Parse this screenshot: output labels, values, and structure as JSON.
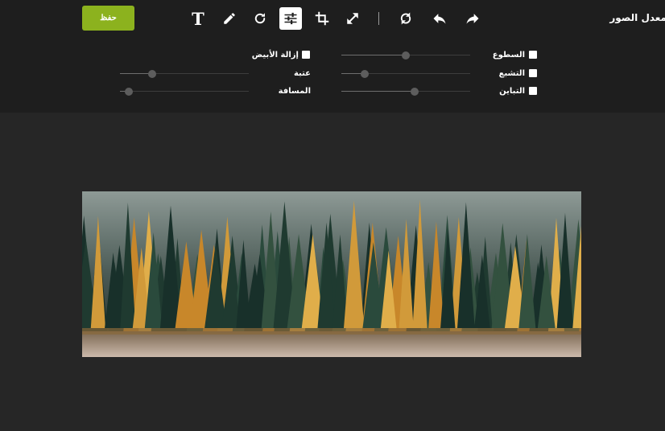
{
  "app": {
    "title": "معدل الصور"
  },
  "toolbar": {
    "save_label": "حفظ",
    "tools": [
      {
        "icon": "text-icon",
        "glyph": "T"
      },
      {
        "icon": "pencil-icon"
      },
      {
        "icon": "rotate-icon"
      },
      {
        "icon": "adjust-sliders-icon",
        "active": true
      },
      {
        "icon": "crop-icon"
      },
      {
        "icon": "resize-icon"
      },
      {
        "icon": "reset-icon"
      },
      {
        "icon": "undo-icon"
      },
      {
        "icon": "redo-icon"
      }
    ]
  },
  "filters": {
    "brightness": {
      "label": "السطوع",
      "checked": false,
      "value": 0.5
    },
    "saturation": {
      "label": "التشبع",
      "checked": false,
      "value": 0.18
    },
    "contrast": {
      "label": "التباين",
      "checked": false,
      "value": 0.57
    },
    "remove_white": {
      "label": "إزالة الأبيض",
      "checked": false
    },
    "threshold": {
      "label": "عتبة",
      "value": 0.25
    },
    "distance": {
      "label": "المسافة",
      "value": 0.07
    }
  },
  "colors": {
    "accent": "#8cb21e",
    "topbar_bg": "#1e1e1e",
    "canvas_bg": "#262626"
  }
}
